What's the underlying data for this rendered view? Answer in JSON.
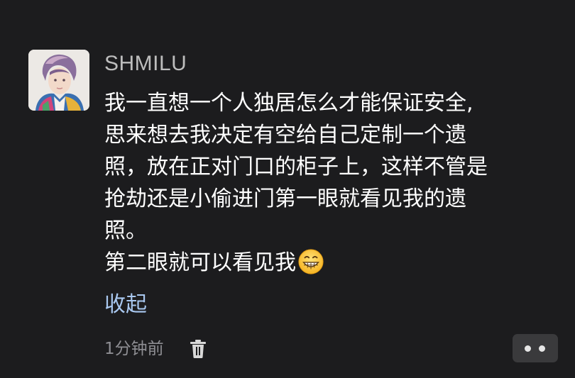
{
  "post": {
    "username": "SHMILU",
    "content_lines": [
      "我一直想一个人独居怎么才能保证安全,",
      "思来想去我决定有空给自己定制一个遗",
      "照，放在正对门口的柜子上，这样不管是",
      "抢劫还是小偷进门第一眼就看见我的遗",
      "照。",
      "第二眼就可以看见我"
    ],
    "emoji": "grinning-face-emoji",
    "collapse_label": "收起",
    "timestamp": "1分钟前",
    "delete_icon": "trash-icon",
    "more_icon": "more-dots-icon"
  }
}
